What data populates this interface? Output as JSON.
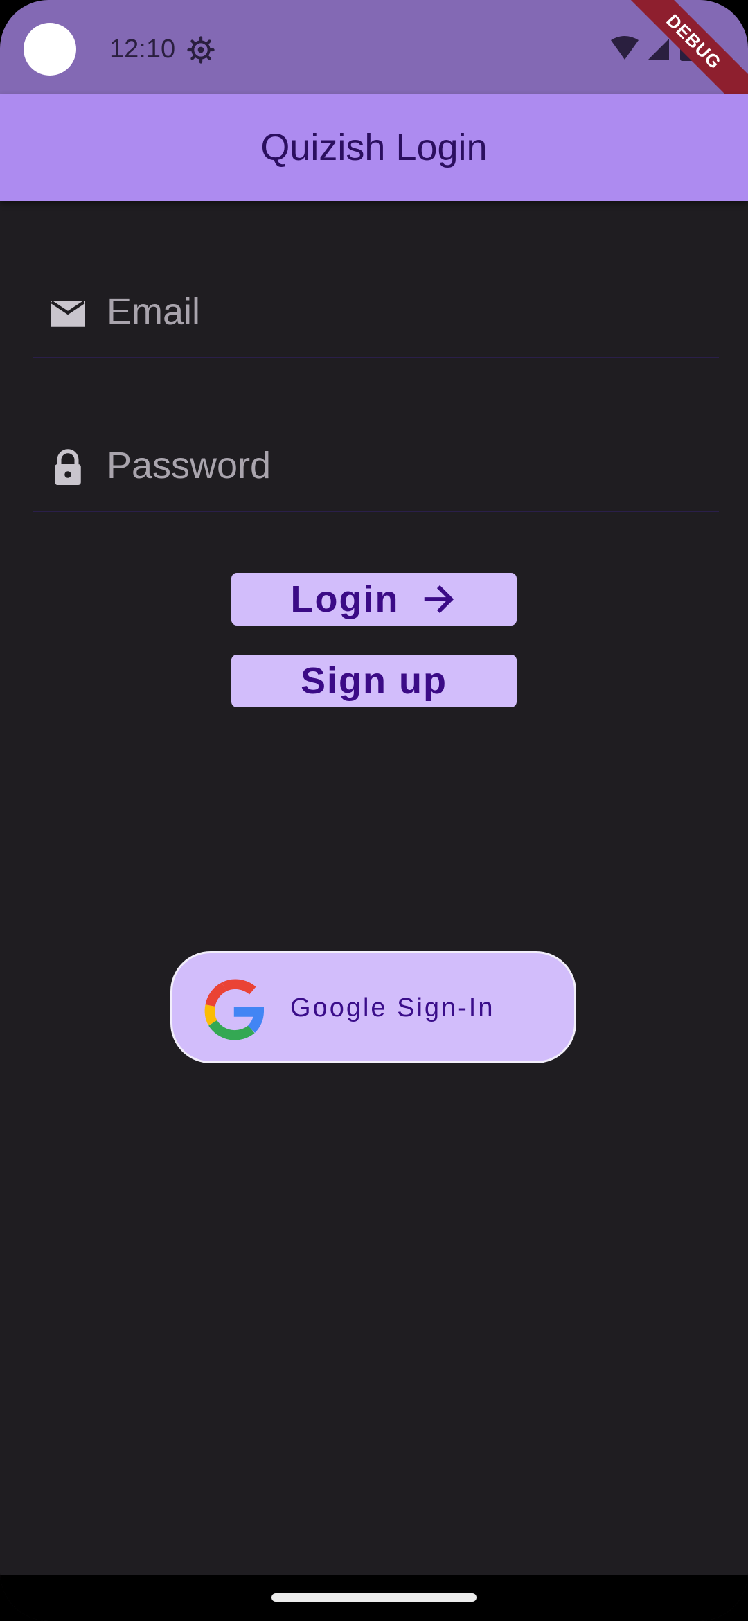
{
  "status_bar": {
    "time": "12:10",
    "debug_label": "DEBUG"
  },
  "app_bar": {
    "title": "Quizish Login"
  },
  "form": {
    "email": {
      "placeholder": "Email",
      "value": ""
    },
    "password": {
      "placeholder": "Password",
      "value": ""
    }
  },
  "buttons": {
    "login_label": "Login",
    "signup_label": "Sign up",
    "google_label": "Google Sign-In"
  },
  "icons": {
    "email": "mail-icon",
    "password": "lock-icon",
    "login_arrow": "arrow-right-icon",
    "google": "google-logo-icon"
  },
  "colors": {
    "app_bar": "#ad8bf0",
    "status_bar": "#8369b4",
    "background": "#1f1d21",
    "button_bg": "#d2bdfb",
    "button_text": "#3b0b86"
  }
}
